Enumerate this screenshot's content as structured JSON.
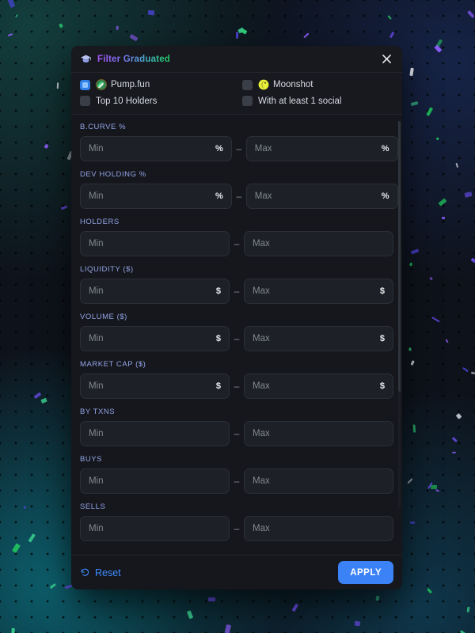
{
  "panel": {
    "title": "Filter Graduated",
    "title_icon": "graduation-cap-icon",
    "close_icon": "close-icon",
    "accent_blue": "#3b82f6",
    "label_color": "#93a4e8"
  },
  "toggles": [
    {
      "label": "Pump.fun",
      "checked": true,
      "brand_icon": "pumpfun-icon"
    },
    {
      "label": "Moonshot",
      "checked": false,
      "brand_icon": "moonshot-icon"
    },
    {
      "label": "Top 10 Holders",
      "checked": false,
      "brand_icon": null
    },
    {
      "label": "With at least 1 social",
      "checked": false,
      "brand_icon": null
    }
  ],
  "fields": [
    {
      "label": "B.CURVE %",
      "min_placeholder": "Min",
      "max_placeholder": "Max",
      "min_value": "",
      "max_value": "",
      "unit": "%"
    },
    {
      "label": "DEV HOLDING %",
      "min_placeholder": "Min",
      "max_placeholder": "Max",
      "min_value": "",
      "max_value": "",
      "unit": "%"
    },
    {
      "label": "HOLDERS",
      "min_placeholder": "Min",
      "max_placeholder": "Max",
      "min_value": "",
      "max_value": "",
      "unit": ""
    },
    {
      "label": "LIQUIDITY ($)",
      "min_placeholder": "Min",
      "max_placeholder": "Max",
      "min_value": "",
      "max_value": "",
      "unit": "$"
    },
    {
      "label": "VOLUME ($)",
      "min_placeholder": "Min",
      "max_placeholder": "Max",
      "min_value": "",
      "max_value": "",
      "unit": "$"
    },
    {
      "label": "MARKET CAP ($)",
      "min_placeholder": "Min",
      "max_placeholder": "Max",
      "min_value": "",
      "max_value": "",
      "unit": "$"
    },
    {
      "label": "BY TXNS",
      "min_placeholder": "Min",
      "max_placeholder": "Max",
      "min_value": "",
      "max_value": "",
      "unit": ""
    },
    {
      "label": "BUYS",
      "min_placeholder": "Min",
      "max_placeholder": "Max",
      "min_value": "",
      "max_value": "",
      "unit": ""
    },
    {
      "label": "SELLS",
      "min_placeholder": "Min",
      "max_placeholder": "Max",
      "min_value": "",
      "max_value": "",
      "unit": ""
    }
  ],
  "range_separator": "–",
  "footer": {
    "reset_label": "Reset",
    "reset_icon": "undo-icon",
    "apply_label": "APPLY"
  }
}
